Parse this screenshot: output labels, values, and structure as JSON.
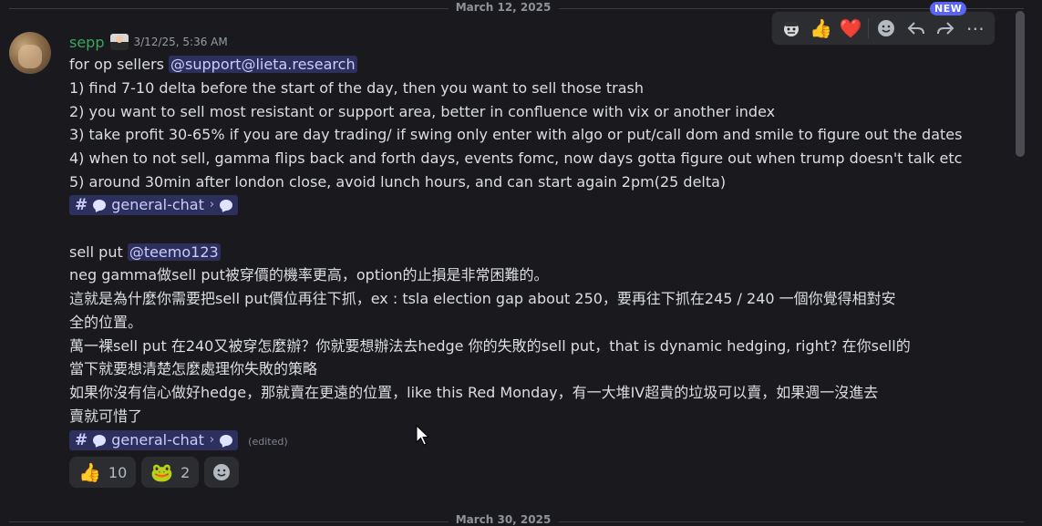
{
  "dividers": {
    "top": "March 12, 2025",
    "bottom": "March 30, 2025"
  },
  "message": {
    "username": "sepp",
    "timestamp": "3/12/25, 5:36 AM",
    "lines": {
      "l1_text": "for op sellers ",
      "l1_mention": "@support@lieta.research",
      "l2": "1) find  7-10 delta before the start of the day, then you want to sell those trash",
      "l3": "2) you want to sell most resistant or support area, better in confluence with vix or another index",
      "l4": "3) take profit 30-65% if you are day trading/ if swing only enter with algo or put/call dom and smile to figure out the dates",
      "l5": "4) when to not sell, gamma flips back and forth days, events fomc, now days gotta figure out when trump doesn't talk etc",
      "l6": "5) around 30min after london close, avoid lunch hours, and can start again 2pm(25 delta)",
      "l8_text": "sell put ",
      "l8_mention": "@teemo123",
      "l9": "neg gamma做sell put被穿價的機率更高，option的止損是非常困難的。",
      "l10": "這就是為什麼你需要把sell put價位再往下抓，ex : tsla election gap about 250，要再往下抓在245 / 240 一個你覺得相對安",
      "l11": "全的位置。",
      "l12": "萬一裸sell put 在240又被穿怎麼辦？你就要想辦法去hedge 你的失敗的sell put，that is dynamic hedging, right? 在你sell的",
      "l13": "當下就要想清楚怎麼處理你失敗的策略",
      "l14": "如果你沒有信心做好hedge，那就賣在更遠的位置，like this Red Monday，有一大堆IV超貴的垃圾可以賣，如果週一沒進去",
      "l15": "賣就可惜了"
    },
    "channel": {
      "hash": "#",
      "name": "general-chat",
      "chevron": "›"
    },
    "edited": "(edited)",
    "reactions": [
      {
        "emoji": "👍",
        "count": "10"
      },
      {
        "emoji": "🐸",
        "count": "2"
      }
    ]
  },
  "toolbar": {
    "new_badge": "NEW",
    "icons": [
      "avatar-emoji-icon",
      "thumbs-up-icon",
      "heart-icon",
      "add-reaction-icon",
      "reply-icon",
      "forward-icon",
      "more-icon"
    ],
    "thumbs": "👍",
    "heart": "❤️",
    "more": "⋯"
  },
  "colors": {
    "background": "#1a1a1e",
    "username": "#3ba55c",
    "mention_bg": "#3c4270",
    "accent": "#5865f2"
  }
}
